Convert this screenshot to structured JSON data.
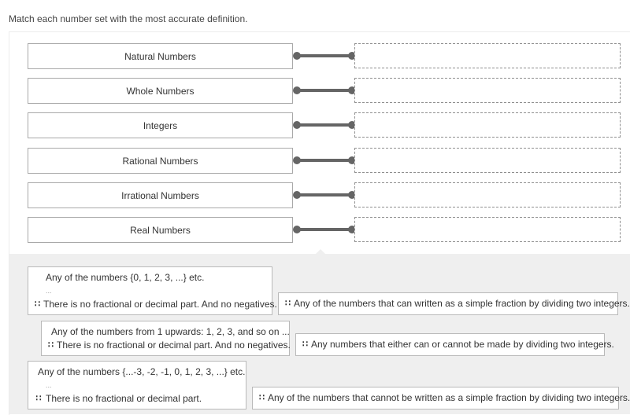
{
  "question": {
    "prompt": "Match each number set with the most accurate definition."
  },
  "stems": [
    {
      "label": "Natural Numbers"
    },
    {
      "label": "Whole Numbers"
    },
    {
      "label": "Integers"
    },
    {
      "label": "Rational Numbers"
    },
    {
      "label": "Irrational Numbers"
    },
    {
      "label": "Real Numbers"
    }
  ],
  "drop_targets": [
    {
      "value": ""
    },
    {
      "value": ""
    },
    {
      "value": ""
    },
    {
      "value": ""
    },
    {
      "value": ""
    },
    {
      "value": ""
    }
  ],
  "answer_cards": [
    {
      "line1": "Any of the numbers {0, 1, 2, 3, ...} etc.",
      "line2": "...",
      "line3": "There is no fractional or decimal part. And no negatives."
    },
    {
      "line1": "Any of the numbers that can written as a simple fraction by dividing two integers."
    },
    {
      "line1": "Any of the numbers from 1 upwards: 1, 2, 3, and so on ...",
      "line2": "There is no fractional or decimal part. And no negatives."
    },
    {
      "line1": "Any numbers that either can or cannot be made by dividing two integers."
    },
    {
      "line1": "Any of the numbers {...-3, -2, -1, 0, 1, 2, 3, ...} etc.",
      "line2": "...",
      "line3": "There is no fractional or decimal part."
    },
    {
      "line1": "Any of the numbers that cannot be written as a simple fraction by dividing two integers."
    }
  ],
  "icons": {
    "drag_handle": "∷"
  }
}
